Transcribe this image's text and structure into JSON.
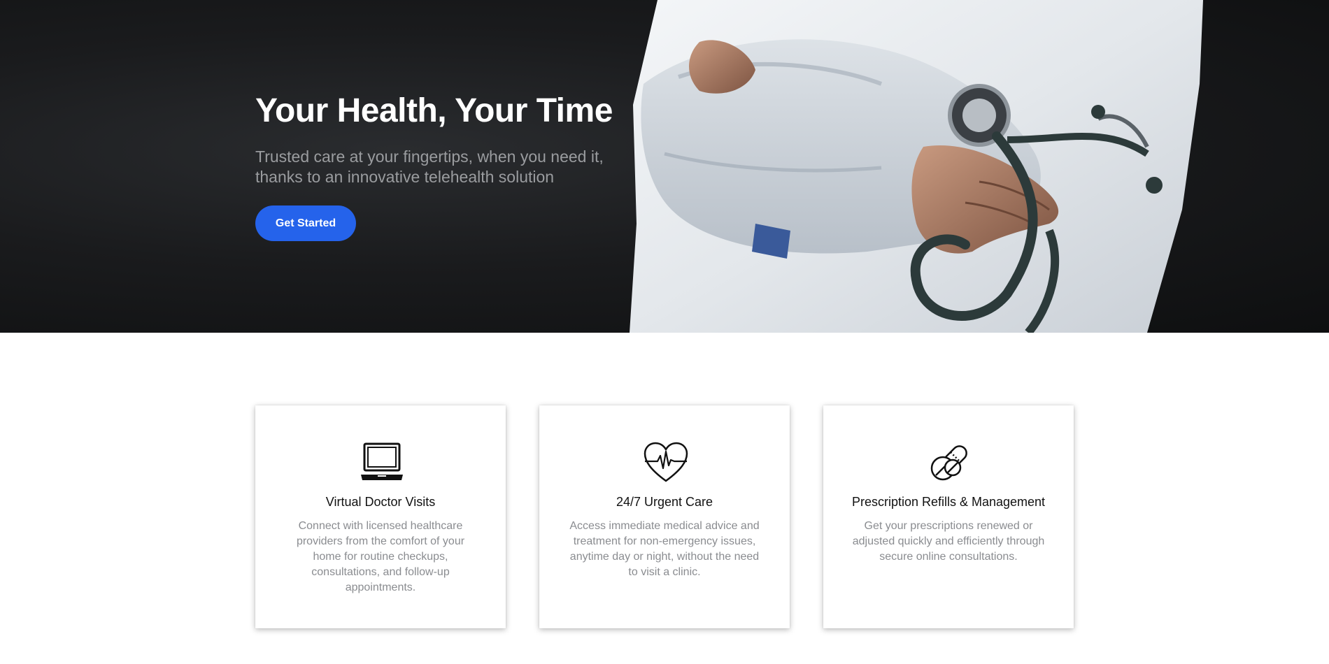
{
  "hero": {
    "title": "Your Health, Your Time",
    "subtitle": "Trusted care at your fingertips, when you need it, thanks to an innovative telehealth solution",
    "cta_label": "Get Started",
    "image": "doctor-with-stethoscope-photo"
  },
  "features": [
    {
      "icon": "laptop-icon",
      "title": "Virtual Doctor Visits",
      "description": "Connect with licensed healthcare providers from the comfort of your home for routine checkups, consultations, and follow-up appointments."
    },
    {
      "icon": "heart-pulse-icon",
      "title": "24/7 Urgent Care",
      "description": "Access immediate medical advice and treatment for non-emergency issues, anytime day or night, without the need to visit a clinic."
    },
    {
      "icon": "pills-icon",
      "title": "Prescription Refills & Management",
      "description": "Get your prescriptions renewed or adjusted quickly and efficiently through secure online consultations."
    }
  ],
  "colors": {
    "hero_bg": "#141516",
    "accent": "#2563eb",
    "card_text": "#8a8c90"
  }
}
